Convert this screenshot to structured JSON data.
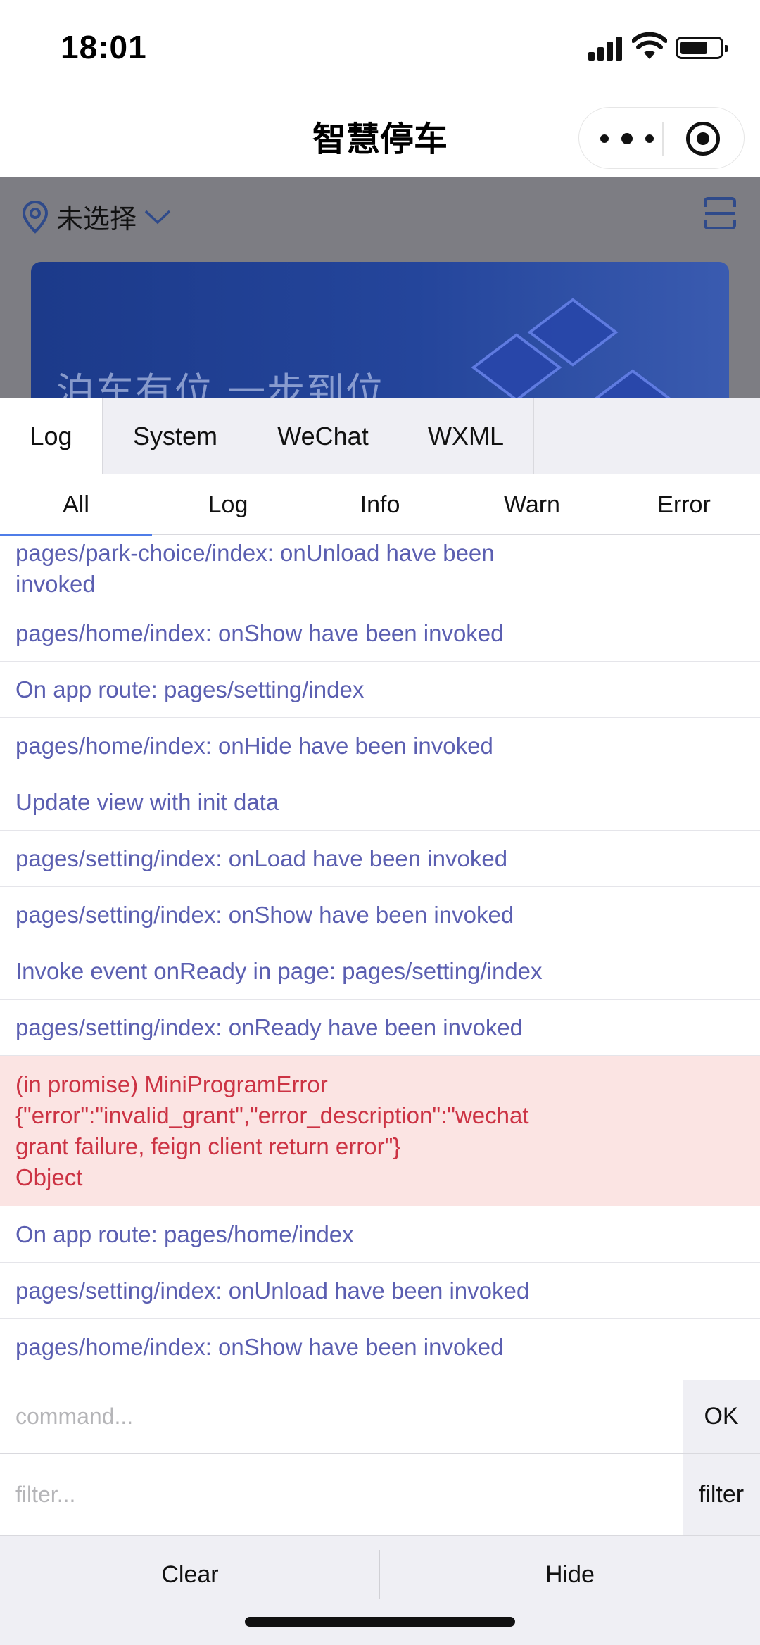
{
  "status_bar": {
    "time": "18:01"
  },
  "nav": {
    "title": "智慧停车"
  },
  "page": {
    "location_label": "未选择",
    "banner_text": "泊车有位 一步到位"
  },
  "console": {
    "top_tabs": [
      {
        "label": "Log",
        "active": true
      },
      {
        "label": "System",
        "active": false
      },
      {
        "label": "WeChat",
        "active": false
      },
      {
        "label": "WXML",
        "active": false
      }
    ],
    "sub_tabs": [
      {
        "label": "All",
        "active": true
      },
      {
        "label": "Log",
        "active": false
      },
      {
        "label": "Info",
        "active": false
      },
      {
        "label": "Warn",
        "active": false
      },
      {
        "label": "Error",
        "active": false
      }
    ],
    "logs": [
      {
        "text": "pages/park-choice/index: onUnload have been invoked",
        "level": "log"
      },
      {
        "text": "pages/home/index: onShow have been invoked",
        "level": "log"
      },
      {
        "text": "On app route: pages/setting/index",
        "level": "log"
      },
      {
        "text": "pages/home/index: onHide have been invoked",
        "level": "log"
      },
      {
        "text": "Update view with init data",
        "level": "log"
      },
      {
        "text": "pages/setting/index: onLoad have been invoked",
        "level": "log"
      },
      {
        "text": "pages/setting/index: onShow have been invoked",
        "level": "log"
      },
      {
        "text": "Invoke event onReady in page: pages/setting/index",
        "level": "log"
      },
      {
        "text": "pages/setting/index: onReady have been invoked",
        "level": "log"
      },
      {
        "level": "error",
        "lines": [
          "(in promise) MiniProgramError",
          "{\"error\":\"invalid_grant\",\"error_description\":\"wechat",
          "grant failure, feign client return error\"}",
          "Object"
        ]
      },
      {
        "text": "On app route: pages/home/index",
        "level": "log"
      },
      {
        "text": "pages/setting/index: onUnload have been invoked",
        "level": "log"
      },
      {
        "text": "pages/home/index: onShow have been invoked",
        "level": "log"
      }
    ],
    "command": {
      "placeholder": "command...",
      "value": "",
      "button": "OK"
    },
    "filter": {
      "placeholder": "filter...",
      "value": "",
      "button": "filter"
    },
    "footer": {
      "clear": "Clear",
      "hide": "Hide"
    }
  },
  "colors": {
    "log_text": "#5b5fb1",
    "error_text": "#cc3344",
    "error_bg": "#fbe4e3",
    "active_tab_underline": "#4f7de8"
  }
}
